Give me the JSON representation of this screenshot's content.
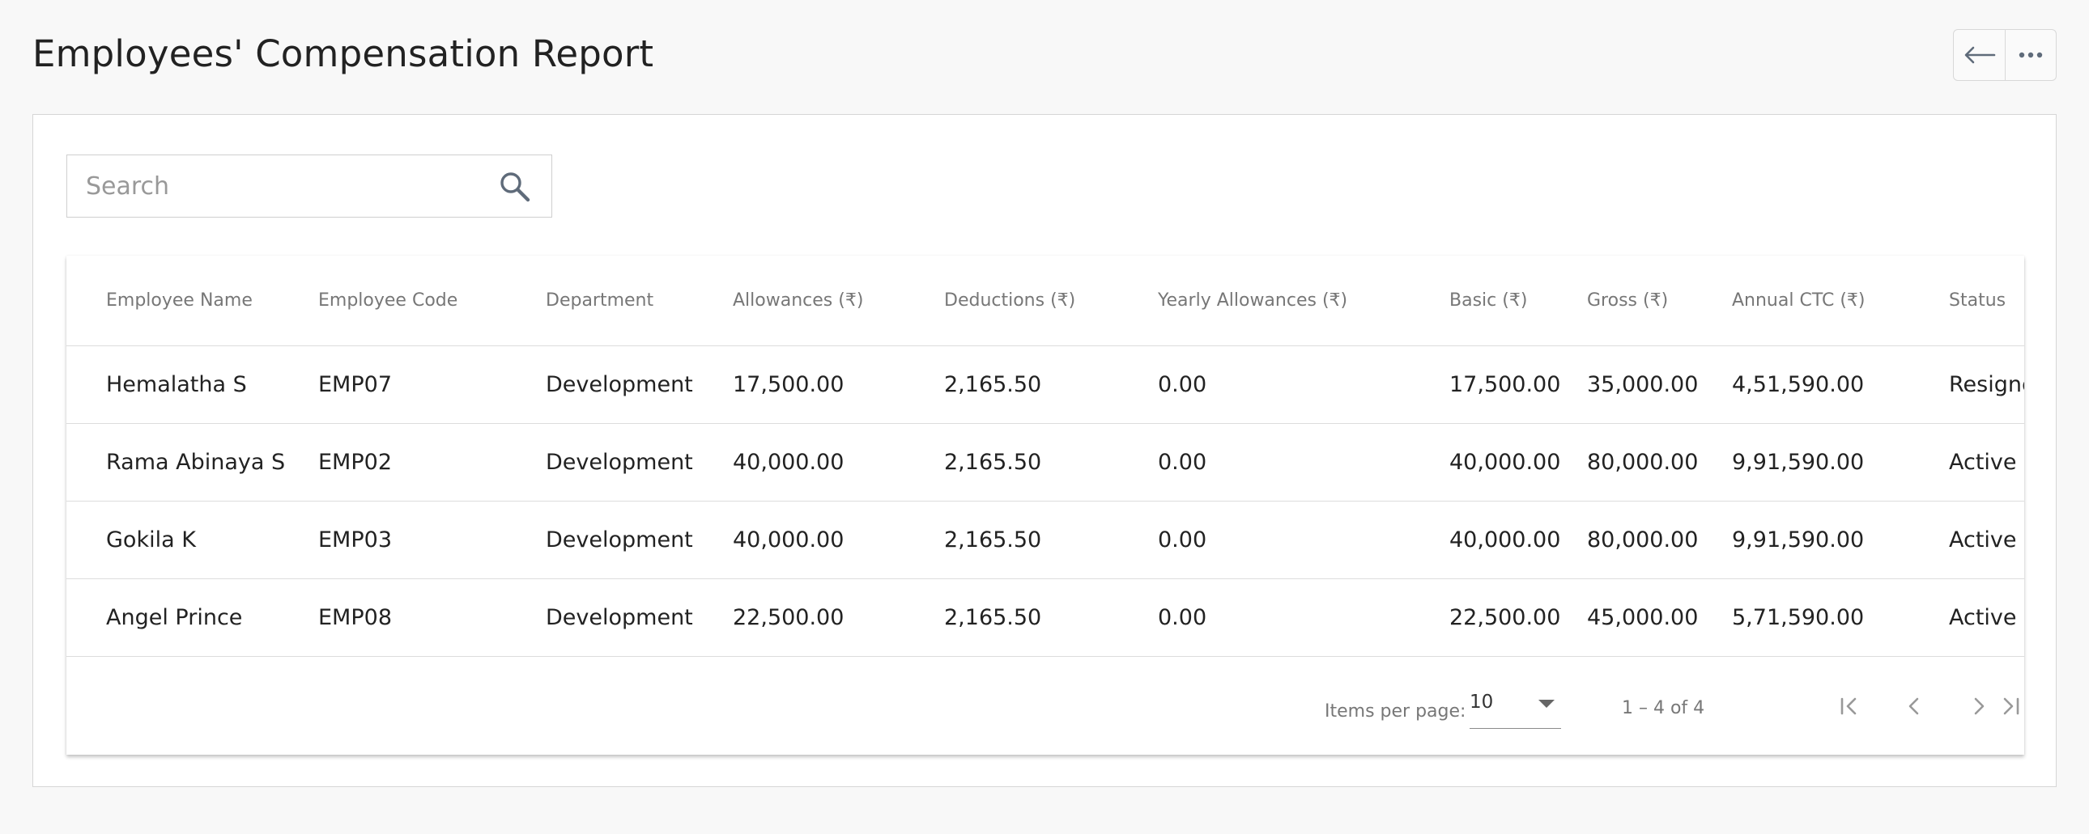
{
  "header": {
    "title": "Employees' Compensation Report",
    "back_icon": "arrow-left-icon",
    "more_icon": "more-horizontal-icon"
  },
  "search": {
    "placeholder": "Search",
    "value": "",
    "icon": "search-icon"
  },
  "table": {
    "columns": [
      "Employee Name",
      "Employee Code",
      "Department",
      "Allowances (₹)",
      "Deductions (₹)",
      "Yearly Allowances (₹)",
      "Basic (₹)",
      "Gross (₹)",
      "Annual CTC (₹)",
      "Status"
    ],
    "rows": [
      [
        "Hemalatha S",
        "EMP07",
        "Development",
        "17,500.00",
        "2,165.50",
        "0.00",
        "17,500.00",
        "35,000.00",
        "4,51,590.00",
        "Resigned"
      ],
      [
        "Rama Abinaya S",
        "EMP02",
        "Development",
        "40,000.00",
        "2,165.50",
        "0.00",
        "40,000.00",
        "80,000.00",
        "9,91,590.00",
        "Active"
      ],
      [
        "Gokila K",
        "EMP03",
        "Development",
        "40,000.00",
        "2,165.50",
        "0.00",
        "40,000.00",
        "80,000.00",
        "9,91,590.00",
        "Active"
      ],
      [
        "Angel Prince",
        "EMP08",
        "Development",
        "22,500.00",
        "2,165.50",
        "0.00",
        "22,500.00",
        "45,000.00",
        "5,71,590.00",
        "Active"
      ]
    ]
  },
  "paginator": {
    "items_per_page_label": "Items per page:",
    "items_per_page_value": "10",
    "range_label": "1 – 4 of 4",
    "first_icon": "first-page-icon",
    "prev_icon": "chevron-left-icon",
    "next_icon": "chevron-right-icon",
    "last_icon": "last-page-icon"
  },
  "colors": {
    "page_background": "#f8f8f8",
    "card_background": "#ffffff",
    "border": "#d6d6d6",
    "header_text": "#777777",
    "cell_text": "#222222",
    "icon": "#5f6b7a"
  }
}
